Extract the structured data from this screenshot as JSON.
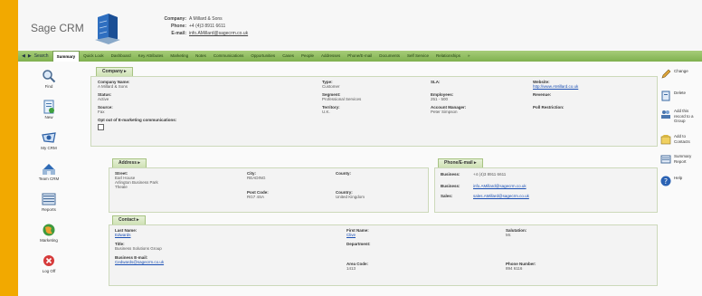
{
  "app": {
    "logo": "Sage CRM"
  },
  "header": {
    "company_label": "Company:",
    "company_value": "A Millard & Sons",
    "phone_label": "Phone:",
    "phone_value": "+4 (4)3 8911 6611",
    "email_label": "E-mail:",
    "email_value": "info.AMillard@sagecrm.co.uk"
  },
  "tabbar": {
    "nav": [
      "◀",
      "▶",
      "Search"
    ],
    "tabs": [
      "Summary",
      "Quick Look",
      "Dashboard",
      "Key Attributes",
      "Marketing",
      "Notes",
      "Communications",
      "Opportunities",
      "Cases",
      "People",
      "Addresses",
      "Phone/E-mail",
      "Documents",
      "Self Service",
      "Relationships",
      "»"
    ]
  },
  "sidebar": {
    "items": [
      "Find",
      "New",
      "My CRM",
      "Team CRM",
      "Reports",
      "Marketing",
      "Log Off"
    ]
  },
  "company_panel": {
    "title": "Company ▸",
    "fields": {
      "company_name_label": "Company Name:",
      "company_name": "A Millard & Sons",
      "status_label": "Status:",
      "status": "Active",
      "source_label": "Source:",
      "source": "Fax",
      "type_label": "Type:",
      "type": "Customer",
      "segment_label": "Segment:",
      "segment": "Professional Services",
      "territory_label": "Territory:",
      "territory": "U.K.",
      "sla_label": "SLA:",
      "employees_label": "Employees:",
      "employees": "251 - 500",
      "account_manager_label": "Account Manager:",
      "account_manager": "Peter Simpson",
      "website_label": "Website:",
      "website": "http://www.AMillard.co.uk",
      "revenue_label": "Revenue:",
      "poll_restriction_label": "Poll Restriction:",
      "opt_out_label": "Opt out of E-marketing communications:"
    }
  },
  "address_panel": {
    "title": "Address ▸",
    "street_label": "Street:",
    "street": [
      "Earl House",
      "Arlington Business Park",
      "Theale"
    ],
    "city_label": "City:",
    "city": "READING",
    "county_label": "County:",
    "post_code_label": "Post Code:",
    "post_code": "RG7 4SA",
    "country_label": "Country:",
    "country": "United Kingdom"
  },
  "phone_panel": {
    "title": "Phone/E-mail ▸",
    "business_label": "Business:",
    "business_phone": "+4 (4)3 8911 6611",
    "business_email_label": "Business:",
    "business_email": "info.AMillard@sagecrm.co.uk",
    "sales_label": "Sales:",
    "sales_email": "sales.AMillard@sagecrm.co.uk"
  },
  "contact_panel": {
    "title": "Contact ▸",
    "last_name_label": "Last Name:",
    "last_name": "Edwards",
    "title_label": "Title:",
    "title_value": "Business Solutions Group",
    "business_email_label": "Business E-mail:",
    "business_email": "Cedwards@sagecrm.co.uk",
    "first_name_label": "First Name:",
    "first_name": "Clive",
    "department_label": "Department:",
    "area_code_label": "Area Code:",
    "area_code": "1413",
    "salutation_label": "Salutation:",
    "salutation": "Mr.",
    "phone_number_label": "Phone Number:",
    "phone_number": "894 6116"
  },
  "actions": {
    "items": [
      "Change",
      "Delete",
      "Add this record to a Group",
      "Add to Contacts",
      "Summary Report",
      "Help"
    ]
  },
  "colors": {
    "frame": "#f2a900",
    "tab_green": "#8fbd5e",
    "link": "#1a4fb4"
  }
}
